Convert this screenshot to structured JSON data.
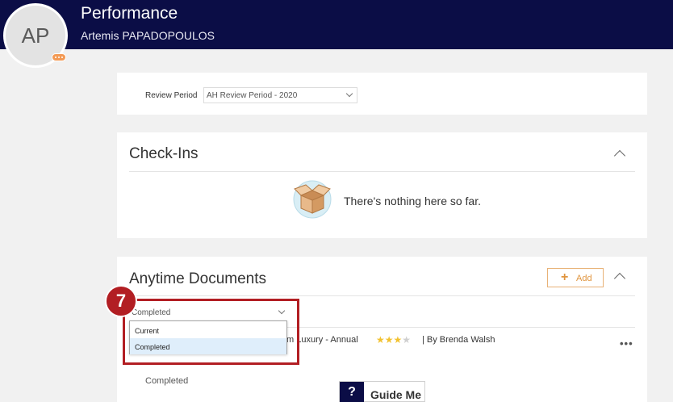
{
  "header": {
    "title": "Performance",
    "user_name": "Artemis PAPADOPOULOS",
    "avatar_initials": "AP",
    "bg_color": "#0b0d46"
  },
  "review_period": {
    "label": "Review Period",
    "value": "AH Review Period - 2020"
  },
  "checkins": {
    "title": "Check-Ins",
    "empty_message": "There's nothing here so far."
  },
  "anytime_documents": {
    "title": "Anytime Documents",
    "add_label": "Add",
    "filter": {
      "selected": "Completed",
      "options": [
        "Current",
        "Completed"
      ]
    },
    "document": {
      "title_fragment": "m Luxury - Annual",
      "rating": 3,
      "rating_max": 4,
      "author": "| By Brenda Walsh",
      "status": "Completed"
    }
  },
  "annotation": {
    "step_number": "7",
    "color": "#b21e23"
  },
  "guide": {
    "icon_label": "?",
    "label": "Guide Me"
  },
  "icons": [
    "chevron-down-icon",
    "chevron-up-icon",
    "open-box-icon",
    "plus-icon",
    "more-icon",
    "star-icon",
    "help-icon"
  ]
}
